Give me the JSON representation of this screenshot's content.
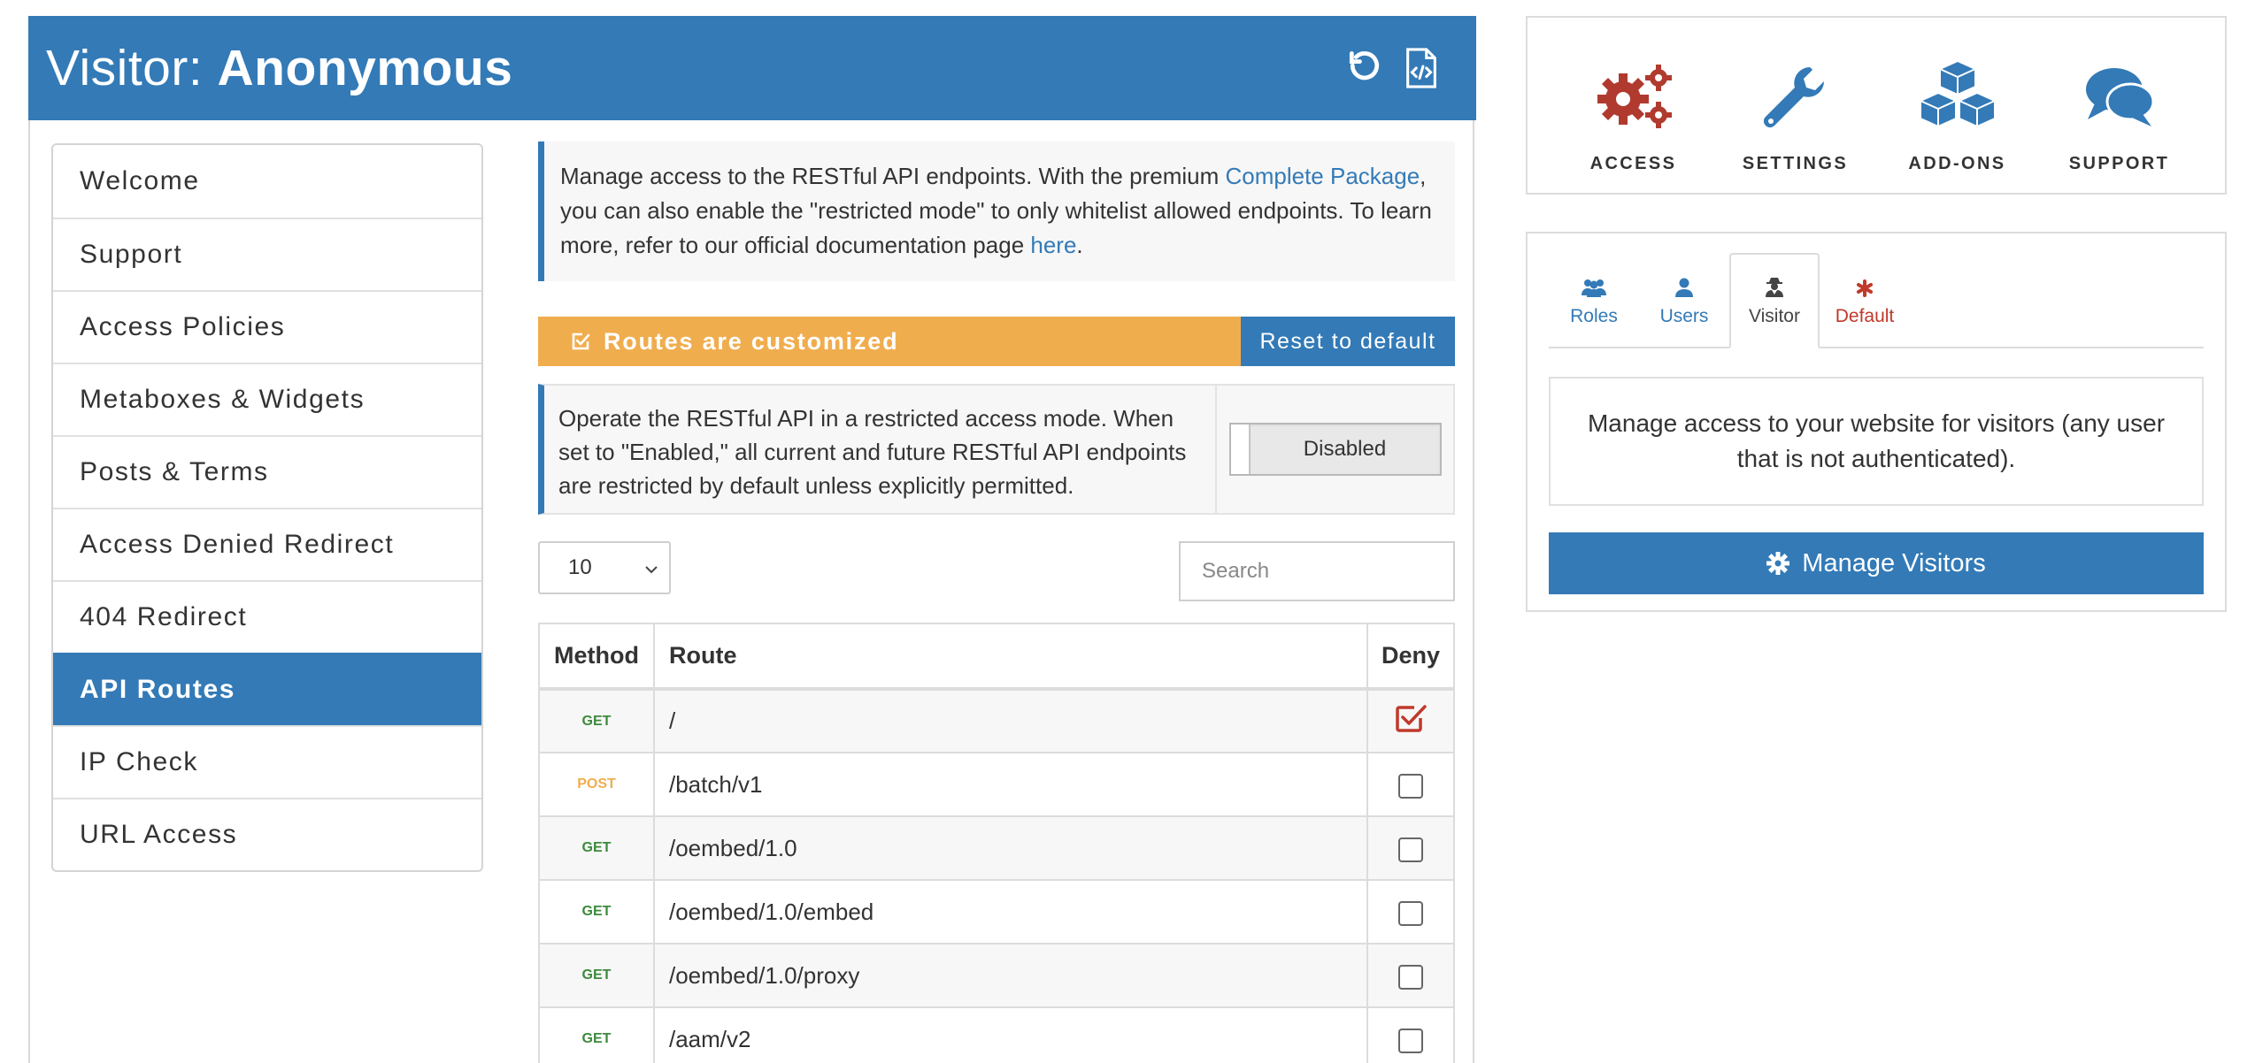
{
  "header": {
    "prefix": "Visitor:",
    "name": "Anonymous"
  },
  "sidebar": {
    "items": [
      {
        "label": "Welcome"
      },
      {
        "label": "Support"
      },
      {
        "label": "Access Policies"
      },
      {
        "label": "Metaboxes & Widgets"
      },
      {
        "label": "Posts & Terms"
      },
      {
        "label": "Access Denied Redirect"
      },
      {
        "label": "404 Redirect"
      },
      {
        "label": "API Routes",
        "active": true
      },
      {
        "label": "IP Check"
      },
      {
        "label": "URL Access"
      }
    ]
  },
  "info": {
    "text1": "Manage access to the RESTful API endpoints. With the premium ",
    "link1": "Complete Package",
    "text2": ", you can also enable the \"restricted mode\" to only whitelist allowed endpoints. To learn more, refer to our official documentation page ",
    "link2": "here",
    "text3": "."
  },
  "status": {
    "label": "Routes are customized",
    "reset_label": "Reset to default",
    "color": "#f0ad4e"
  },
  "restricted": {
    "text": "Operate the RESTful API in a restricted access mode. When set to \"Enabled,\" all current and future RESTful API endpoints are restricted by default unless explicitly permitted.",
    "toggle_label": "Disabled"
  },
  "controls": {
    "page_size": "10",
    "search_placeholder": "Search"
  },
  "table": {
    "headers": {
      "method": "Method",
      "route": "Route",
      "deny": "Deny"
    },
    "rows": [
      {
        "method": "GET",
        "route": "/",
        "deny": true
      },
      {
        "method": "POST",
        "route": "/batch/v1",
        "deny": false
      },
      {
        "method": "GET",
        "route": "/oembed/1.0",
        "deny": false
      },
      {
        "method": "GET",
        "route": "/oembed/1.0/embed",
        "deny": false
      },
      {
        "method": "GET",
        "route": "/oembed/1.0/proxy",
        "deny": false
      },
      {
        "method": "GET",
        "route": "/aam/v2",
        "deny": false
      }
    ]
  },
  "nav": {
    "access": "ACCESS",
    "settings": "SETTINGS",
    "addons": "ADD-ONS",
    "support": "SUPPORT"
  },
  "subject_tabs": {
    "roles": "Roles",
    "users": "Users",
    "visitor": "Visitor",
    "default": "Default"
  },
  "visitor_panel": {
    "description": "Manage access to your website for visitors (any user that is not authenticated).",
    "button_label": "Manage Visitors"
  },
  "colors": {
    "primary": "#337ab7",
    "warning": "#f0ad4e",
    "danger": "#c0392b",
    "get_method": "#3c8a3c"
  }
}
